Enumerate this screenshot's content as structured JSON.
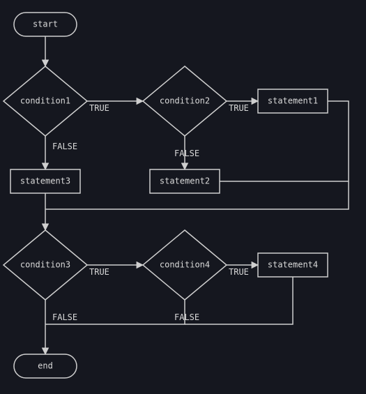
{
  "chart_data": {
    "type": "flowchart",
    "nodes": [
      {
        "id": "start",
        "kind": "terminator",
        "label": "start"
      },
      {
        "id": "cond1",
        "kind": "decision",
        "label": "condition1"
      },
      {
        "id": "cond2",
        "kind": "decision",
        "label": "condition2"
      },
      {
        "id": "stmt1",
        "kind": "process",
        "label": "statement1"
      },
      {
        "id": "stmt2",
        "kind": "process",
        "label": "statement2"
      },
      {
        "id": "stmt3",
        "kind": "process",
        "label": "statement3"
      },
      {
        "id": "cond3",
        "kind": "decision",
        "label": "condition3"
      },
      {
        "id": "cond4",
        "kind": "decision",
        "label": "condition4"
      },
      {
        "id": "stmt4",
        "kind": "process",
        "label": "statement4"
      },
      {
        "id": "end",
        "kind": "terminator",
        "label": "end"
      }
    ],
    "edges": [
      {
        "from": "start",
        "to": "cond1",
        "label": ""
      },
      {
        "from": "cond1",
        "to": "cond2",
        "label": "TRUE"
      },
      {
        "from": "cond1",
        "to": "stmt3",
        "label": "FALSE"
      },
      {
        "from": "cond2",
        "to": "stmt1",
        "label": "TRUE"
      },
      {
        "from": "cond2",
        "to": "stmt2",
        "label": "FALSE"
      },
      {
        "from": "stmt3",
        "to": "cond3",
        "label": ""
      },
      {
        "from": "cond3",
        "to": "cond4",
        "label": "TRUE"
      },
      {
        "from": "cond3",
        "to": "end",
        "label": "FALSE"
      },
      {
        "from": "cond4",
        "to": "stmt4",
        "label": "TRUE"
      },
      {
        "from": "cond4",
        "to": "end",
        "label": "FALSE"
      },
      {
        "from": "stmt1",
        "to": "cond3",
        "label": ""
      },
      {
        "from": "stmt2",
        "to": "cond3",
        "label": ""
      },
      {
        "from": "stmt4",
        "to": "end",
        "label": ""
      }
    ]
  },
  "labels": {
    "start": "start",
    "end": "end",
    "cond1": "condition1",
    "cond2": "condition2",
    "cond3": "condition3",
    "cond4": "condition4",
    "stmt1": "statement1",
    "stmt2": "statement2",
    "stmt3": "statement3",
    "stmt4": "statement4",
    "true": "TRUE",
    "false": "FALSE"
  }
}
